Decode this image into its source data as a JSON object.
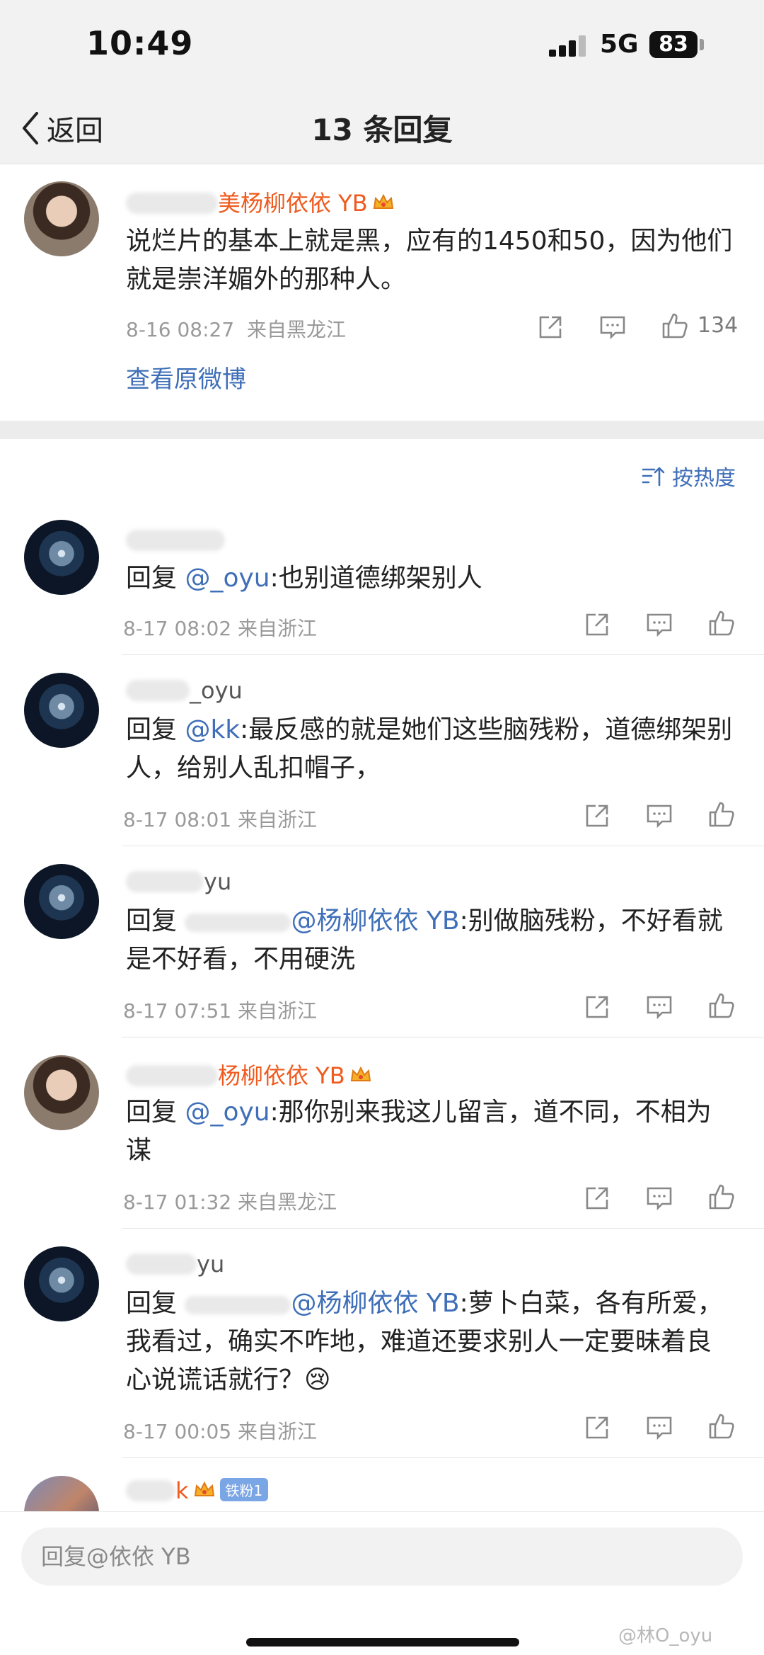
{
  "status_bar": {
    "time": "10:49",
    "network": "5G",
    "battery": "83"
  },
  "nav": {
    "back_label": "返回",
    "title": "13 条回复"
  },
  "main_post": {
    "author_visible": "美杨柳依依 YB",
    "text": "说烂片的基本上就是黑，应有的1450和50，因为他们就是崇洋媚外的那种人。",
    "date": "8-16 08:27",
    "location": "来自黑龙江",
    "likes": "134",
    "view_original": "查看原微博"
  },
  "sort_label": "按热度",
  "replies": [
    {
      "author_visible": "",
      "reply_prefix": "回复 ",
      "mention": "@_oyu",
      "text": ":也别道德绑架别人",
      "date": "8-17 08:02",
      "location": "来自浙江"
    },
    {
      "author_visible": "_oyu",
      "reply_prefix": "回复 ",
      "mention": "@kk",
      "text": ":最反感的就是她们这些脑残粉，道德绑架别人，给别人乱扣帽子，",
      "date": "8-17 08:01",
      "location": "来自浙江"
    },
    {
      "author_visible": "yu",
      "reply_prefix": "回复 ",
      "mention": "@杨柳依依 YB",
      "text": ":别做脑残粉，不好看就是不好看，不用硬洗",
      "date": "8-17 07:51",
      "location": "来自浙江"
    },
    {
      "author_visible": "杨柳依依 YB",
      "reply_prefix": "回复 ",
      "mention": "@_oyu",
      "text": ":那你别来我这儿留言，道不同，不相为谋",
      "date": "8-17 01:32",
      "location": "来自黑龙江"
    },
    {
      "author_visible": "yu",
      "reply_prefix": "回复 ",
      "mention": "@杨柳依依 YB",
      "text": ":萝卜白菜，各有所爱，我看过，确实不咋地，难道还要求别人一定要昧着良心说谎话就行？😢",
      "date": "8-17 00:05",
      "location": "来自浙江"
    },
    {
      "author_visible": "k",
      "badge": "铁粉1"
    }
  ],
  "reply_input": {
    "placeholder": "回复@依依 YB"
  },
  "watermark": "@林O_oyu",
  "icons": [
    "back-chevron-icon",
    "share-icon",
    "comment-icon",
    "like-icon",
    "sort-icon",
    "crown-icon"
  ],
  "colors": {
    "accent_orange": "#f05a1e",
    "link_blue": "#3f6fb8",
    "meta_grey": "#9a9a9a"
  }
}
